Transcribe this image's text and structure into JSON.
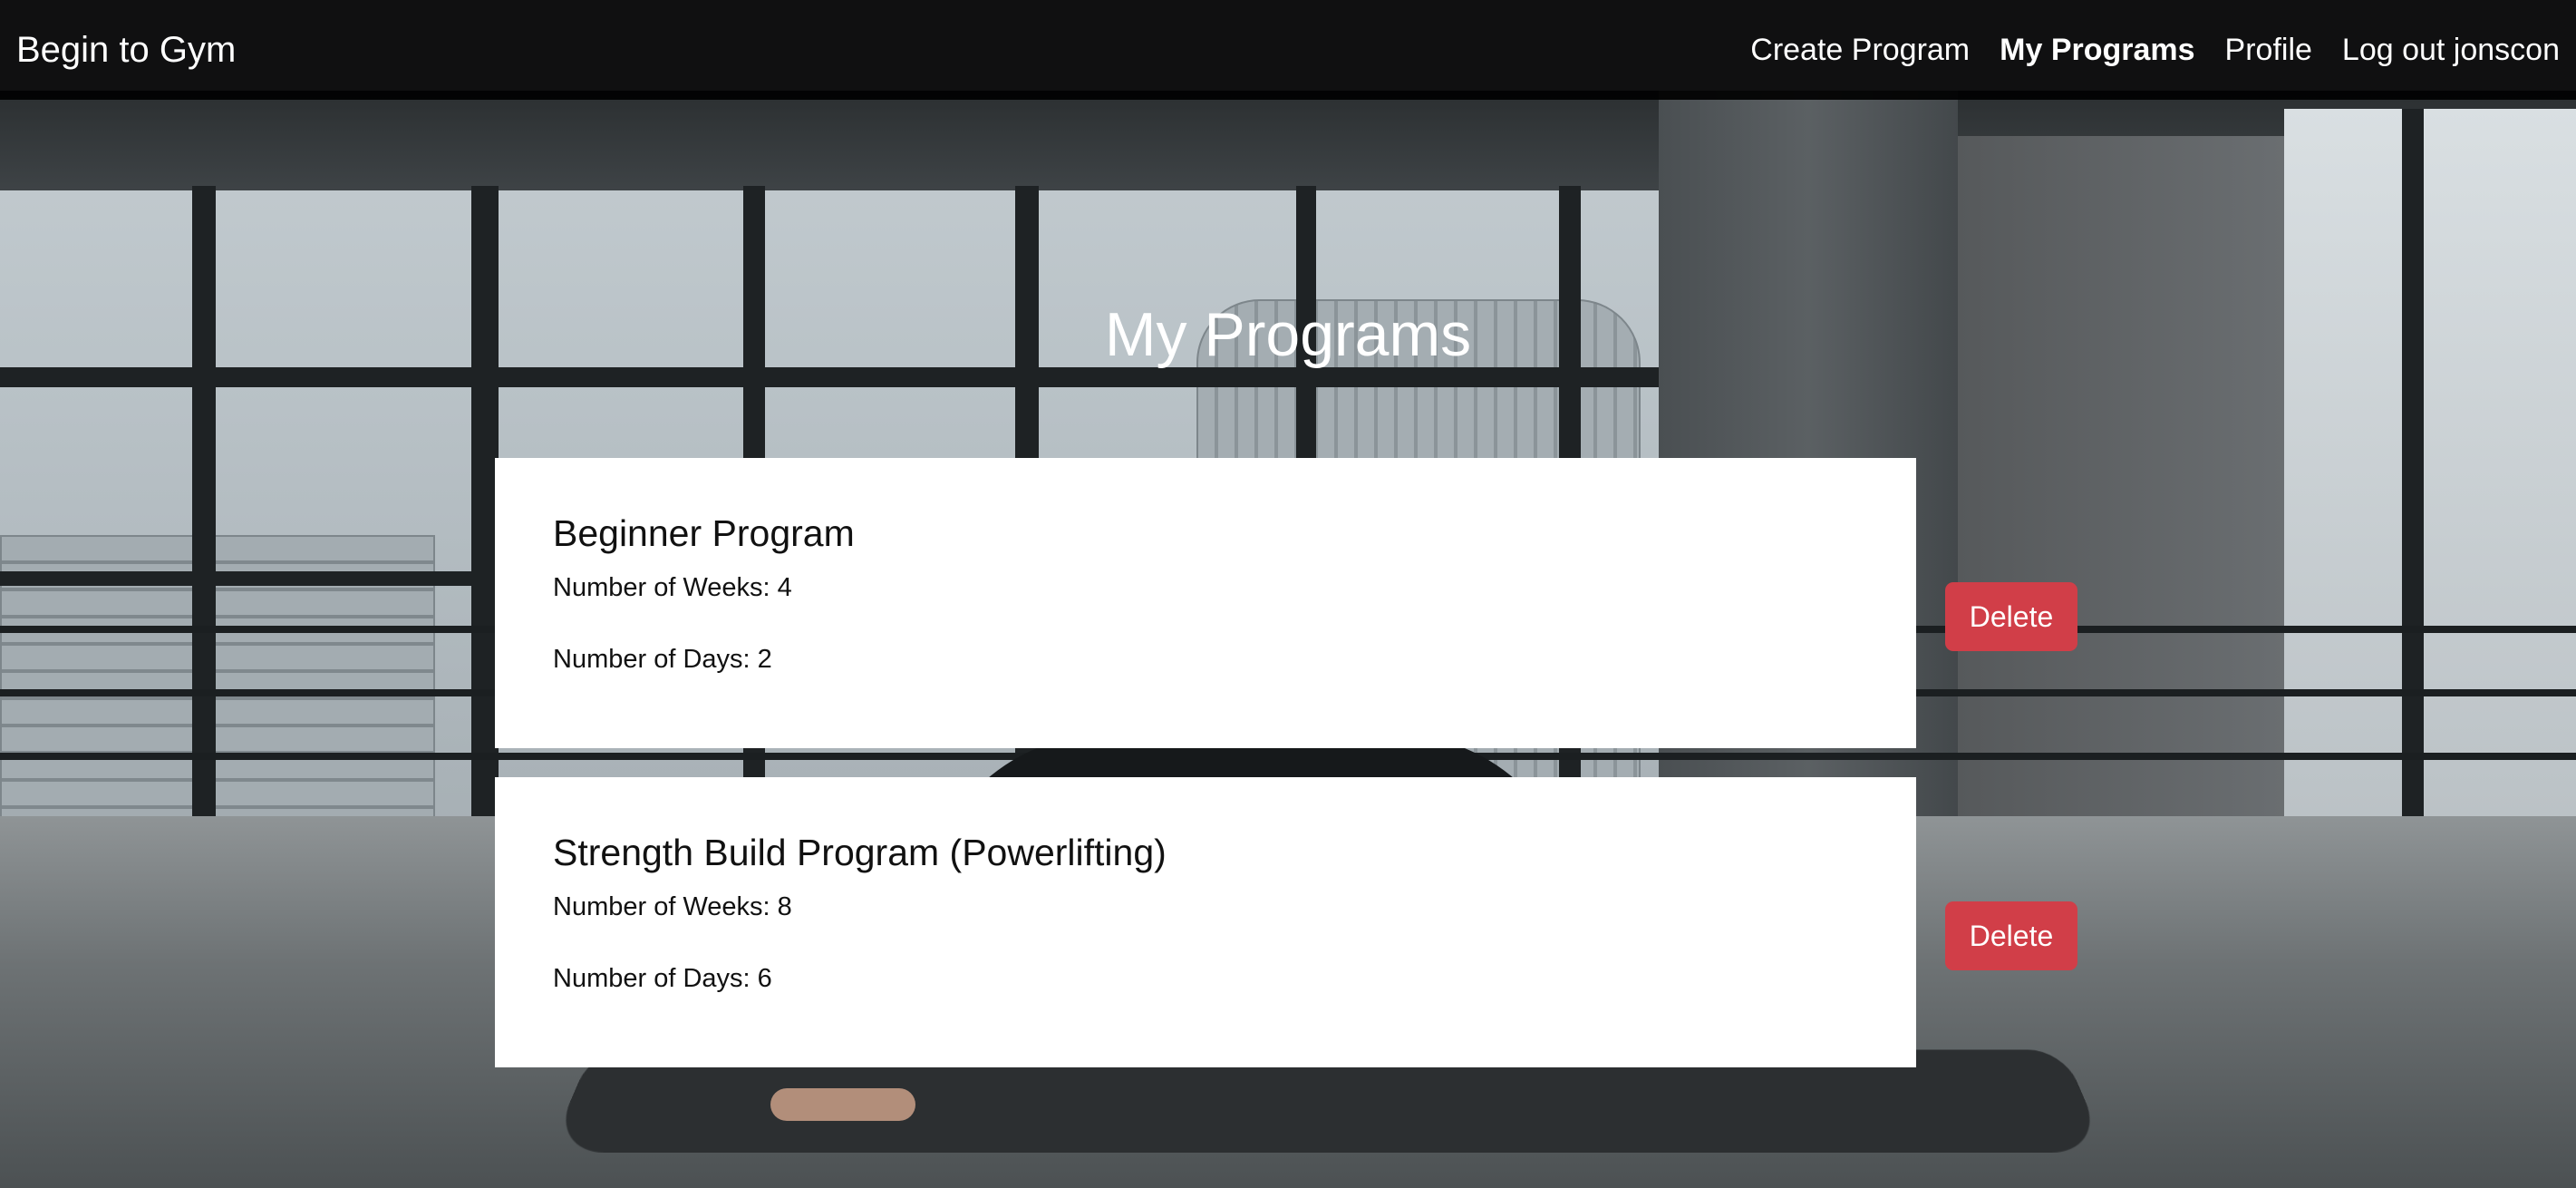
{
  "navbar": {
    "brand": "Begin to Gym",
    "links": [
      {
        "label": "Create Program",
        "active": false
      },
      {
        "label": "My Programs",
        "active": true
      },
      {
        "label": "Profile",
        "active": false
      },
      {
        "label": "Log out jonscon",
        "active": false
      }
    ]
  },
  "page": {
    "title": "My Programs"
  },
  "programs": [
    {
      "name": "Beginner Program",
      "weeks": "Number of Weeks: 4",
      "days": "Number of Days: 2",
      "delete_label": "Delete"
    },
    {
      "name": "Strength Build Program (Powerlifting)",
      "weeks": "Number of Weeks: 8",
      "days": "Number of Days: 6",
      "delete_label": "Delete"
    }
  ],
  "colors": {
    "navbar_bg": "#000000",
    "danger": "#d13e48",
    "card_bg": "#ffffff"
  }
}
